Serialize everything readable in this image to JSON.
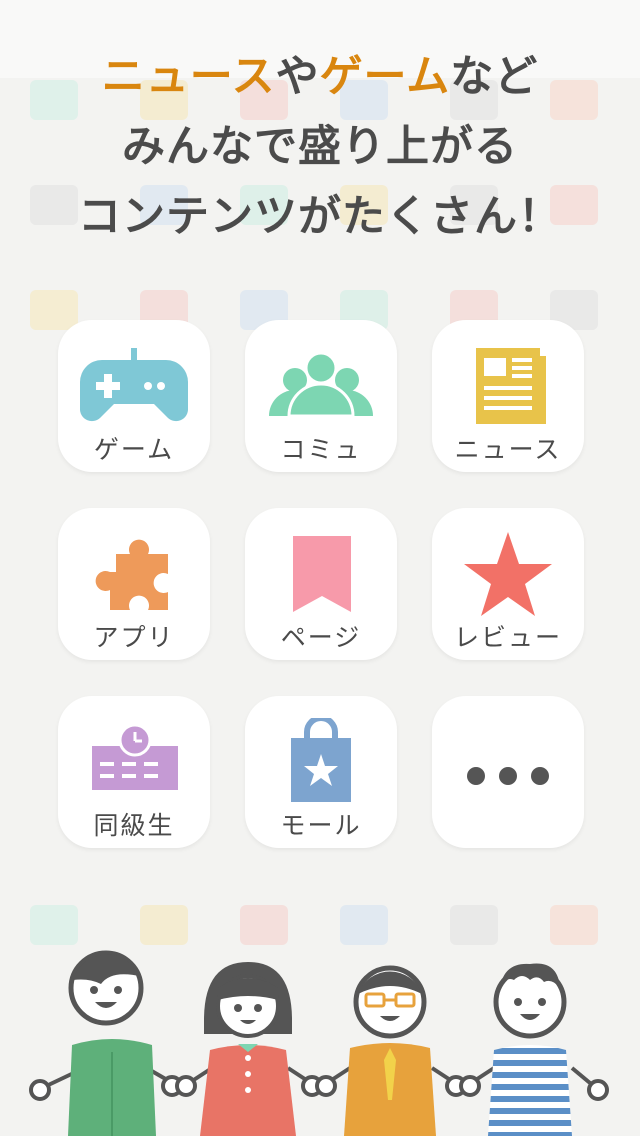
{
  "headline": {
    "line1_part1": "ニュース",
    "line1_part2": "や",
    "line1_part3": "ゲーム",
    "line1_part4": "など",
    "line2": "みんなで盛り上がる",
    "line3": "コンテンツがたくさん！"
  },
  "colors": {
    "accent": "#d9860f",
    "text": "#4b4b4b",
    "game": "#7fc8d6",
    "community": "#7dd6b2",
    "news": "#e8c34a",
    "apps": "#ee9a5a",
    "page": "#f79aaa",
    "review": "#f27167",
    "classmates": "#c59ad4",
    "mall": "#7da4cf"
  },
  "tiles": [
    {
      "label": "ゲーム",
      "icon": "gamepad-icon"
    },
    {
      "label": "コミュ",
      "icon": "community-icon"
    },
    {
      "label": "ニュース",
      "icon": "newspaper-icon"
    },
    {
      "label": "アプリ",
      "icon": "puzzle-icon"
    },
    {
      "label": "ページ",
      "icon": "bookmark-icon"
    },
    {
      "label": "レビュー",
      "icon": "star-icon"
    },
    {
      "label": "同級生",
      "icon": "school-icon"
    },
    {
      "label": "モール",
      "icon": "shopping-bag-icon"
    },
    {
      "label": "",
      "icon": "more-icon"
    }
  ]
}
